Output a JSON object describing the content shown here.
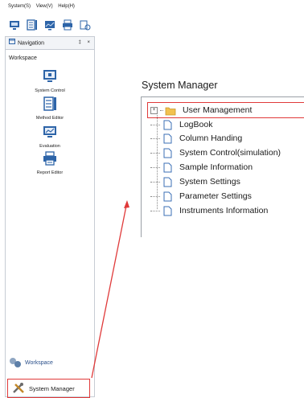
{
  "menubar": {
    "items": [
      "System(S)",
      "View(V)",
      "Help(H)"
    ]
  },
  "navigation": {
    "title": "Navigation",
    "pin_glyph": "‡",
    "close_glyph": "×",
    "workspace_label": "Workspace",
    "items": [
      {
        "label": "System Control",
        "icon": "monitor-icon"
      },
      {
        "label": "Method Editor",
        "icon": "method-editor-icon"
      },
      {
        "label": "Evaluation",
        "icon": "evaluation-icon"
      },
      {
        "label": "Report Editor",
        "icon": "printer-icon"
      }
    ],
    "bottom_workspace": "Workspace",
    "system_manager": "System Manager"
  },
  "system_manager_panel": {
    "title": "System Manager",
    "tree": [
      {
        "label": "User Management",
        "type": "folder",
        "expandable": true
      },
      {
        "label": "LogBook",
        "type": "document"
      },
      {
        "label": "Column Handing",
        "type": "document"
      },
      {
        "label": "System Control(simulation)",
        "type": "document"
      },
      {
        "label": "Sample Information",
        "type": "document"
      },
      {
        "label": "System Settings",
        "type": "document"
      },
      {
        "label": "Parameter Settings",
        "type": "document"
      },
      {
        "label": "Instruments Information",
        "type": "document"
      }
    ]
  },
  "colors": {
    "highlight": "#e03a3a",
    "folder": "#f2c14e",
    "document_border": "#3b6fb6",
    "icon_blue": "#2d64a8"
  }
}
